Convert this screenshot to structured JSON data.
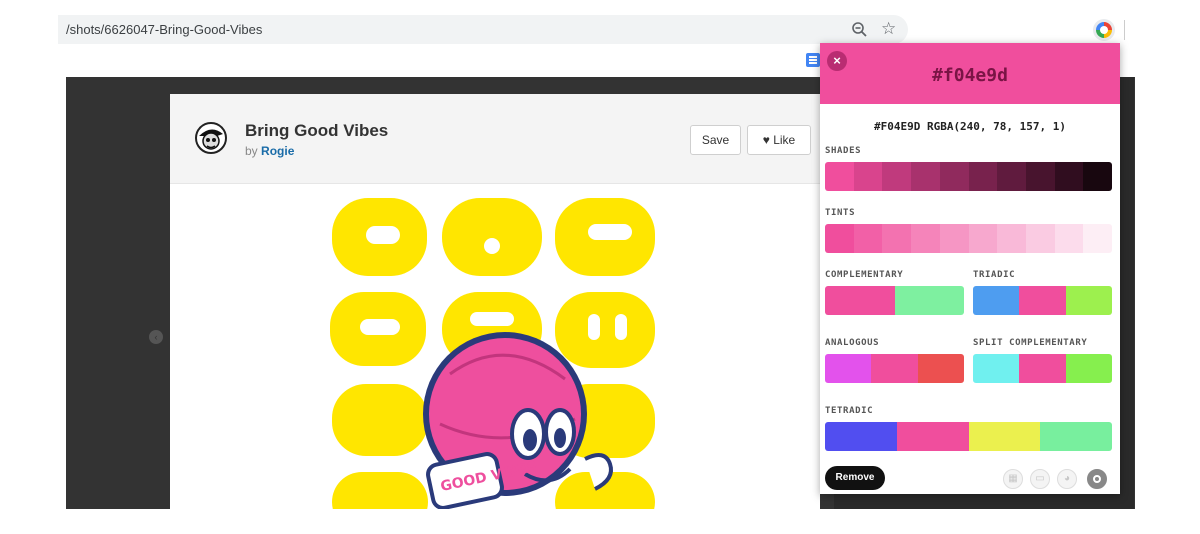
{
  "browser": {
    "url": "/shots/6626047-Bring-Good-Vibes"
  },
  "shot": {
    "title": "Bring Good Vibes",
    "by_prefix": "by",
    "author": "Rogie",
    "save_label": "Save",
    "like_label": "Like",
    "artwork_text": "GOOD VIBES"
  },
  "picker": {
    "hex_value": "#f04e9d",
    "readout": "#F04E9D  RGBA(240, 78, 157, 1)",
    "base_color": "#f04e9d",
    "sections": {
      "shades": {
        "label": "SHADES",
        "colors": [
          "#f04e9d",
          "#d9448d",
          "#c03a7d",
          "#a8326d",
          "#902a5d",
          "#78224d",
          "#601b3e",
          "#48142e",
          "#300d1f",
          "#18070f"
        ]
      },
      "tints": {
        "label": "TINTS",
        "colors": [
          "#f04e9d",
          "#f260a7",
          "#f372b0",
          "#f584ba",
          "#f696c4",
          "#f7a8ce",
          "#f9b9d8",
          "#facbe2",
          "#fcdcec",
          "#fdeef5"
        ]
      },
      "complementary": {
        "label": "COMPLEMENTARY",
        "colors": [
          "#f04e9d",
          "#7ef0a0"
        ]
      },
      "triadic": {
        "label": "TRIADIC",
        "colors": [
          "#4e9df0",
          "#f04e9d",
          "#9df04e"
        ]
      },
      "analogous": {
        "label": "ANALOGOUS",
        "colors": [
          "#e352ec",
          "#f04e9d",
          "#ec5050"
        ]
      },
      "split_complementary": {
        "label": "SPLIT COMPLEMENTARY",
        "colors": [
          "#70f0ef",
          "#f04e9d",
          "#86ef4e"
        ]
      },
      "tetradic": {
        "label": "TETRADIC",
        "colors": [
          "#514ef0",
          "#f04e9d",
          "#ebf04e",
          "#78ef9e"
        ]
      }
    },
    "remove_label": "Remove"
  }
}
